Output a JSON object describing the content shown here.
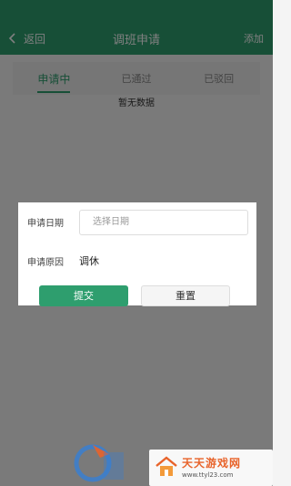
{
  "header": {
    "back_label": "返回",
    "title": "调班申请",
    "add_label": "添加",
    "color": "#2e9e6e"
  },
  "tabs": [
    {
      "label": "申请中",
      "active": true
    },
    {
      "label": "已通过",
      "active": false
    },
    {
      "label": "已驳回",
      "active": false
    }
  ],
  "empty_text": "暂无数据",
  "dialog": {
    "date_label": "申请日期",
    "date_placeholder": "选择日期",
    "reason_label": "申请原因",
    "reason_value": "调休",
    "submit_label": "提交",
    "reset_label": "重置"
  },
  "watermark": {
    "title": "天天游戏网",
    "url": "www.ttyl23.com"
  }
}
